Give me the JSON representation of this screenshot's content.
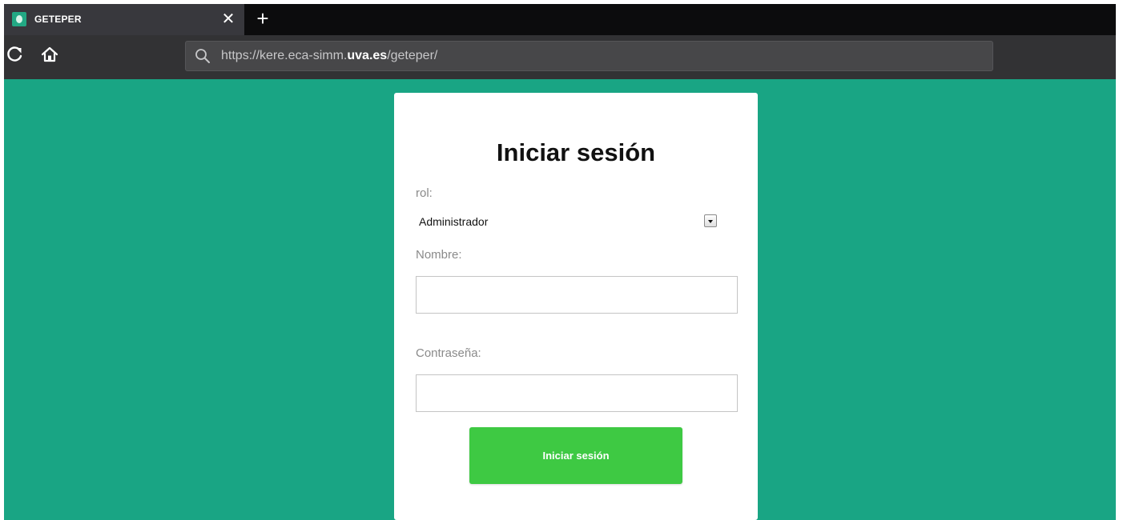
{
  "browser": {
    "tab": {
      "title": "GETEPER",
      "close_glyph": "✕",
      "new_tab_glyph": "+"
    },
    "url": {
      "prefix": "https://kere.eca-simm.",
      "domain": "uva.es",
      "path": "/geteper/"
    },
    "icons": {
      "reload": "reload-icon",
      "home": "home-icon",
      "search": "search-icon",
      "favicon": "site-favicon"
    }
  },
  "login": {
    "title": "Iniciar sesión",
    "rol_label": "rol:",
    "rol_selected": "Administrador",
    "nombre_label": "Nombre:",
    "nombre_value": "",
    "password_label": "Contraseña:",
    "password_value": "",
    "submit_label": "Iniciar sesión"
  },
  "colors": {
    "page_background": "#19a584",
    "submit_button": "#3ec943",
    "tabstrip": "#0c0c0d",
    "navbar": "#323234"
  }
}
